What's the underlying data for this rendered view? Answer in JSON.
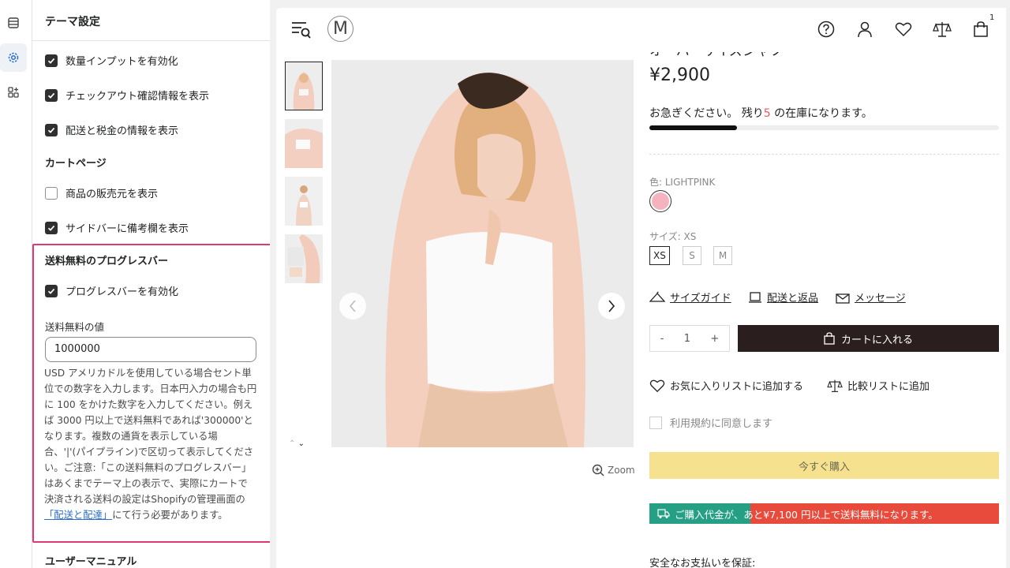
{
  "sidebar": {
    "title": "テーマ設定",
    "options": [
      {
        "label": "数量インプットを有効化",
        "checked": true
      },
      {
        "label": "チェックアウト確認情報を表示",
        "checked": true
      },
      {
        "label": "配送と税金の情報を表示",
        "checked": true
      }
    ],
    "cart_section_title": "カートページ",
    "cart_options": [
      {
        "label": "商品の販売元を表示",
        "checked": false
      },
      {
        "label": "サイドバーに備考欄を表示",
        "checked": true
      }
    ],
    "progress_section_title": "送料無料のプログレスバー",
    "progress_enable_label": "プログレスバーを有効化",
    "free_value_label": "送料無料の値",
    "free_value": "1000000",
    "help_text_before": "USD アメリカドルを使用している場合セント単位での数字を入力します。日本円入力の場合も円に 100 をかけた数字を入力してください。例えば 3000 円以上で送料無料であれば'300000'となります。複数の通貨を表示している場合、'|'(パイプライン)で区切って表示してください。ご注意:「この送料無料のプログレスバー」はあくまでテーマ上の表示で、実際にカートで決済される送料の設定はShopifyの管理画面の",
    "help_link": "「配送と配達」",
    "help_text_after": "にて行う必要があります。",
    "next_section_title": "ユーザーマニュアル"
  },
  "store": {
    "logo_letter": "M",
    "cart_count": "1",
    "title_cut": "オーバーサイズシャツ",
    "price": "¥2,900",
    "hurry_before": "お急ぎください。 残り",
    "hurry_count": "5",
    "hurry_after": " の在庫になります。",
    "stock_fraction": 0.25,
    "color_label": "色: LIGHTPINK",
    "swatch_color": "#f4b3bf",
    "size_label": "サイズ: XS",
    "sizes": [
      "XS",
      "S",
      "M"
    ],
    "size_guide": "サイズガイド",
    "shipping_returns": "配送と返品",
    "message": "メッセージ",
    "qty_minus": "-",
    "qty_value": "1",
    "qty_plus": "+",
    "add_to_cart": "カートに入れる",
    "add_wishlist": "お気に入りリストに追加する",
    "add_compare": "比較リストに追加",
    "terms": "利用規約に同意します",
    "buy_now": "今すぐ購入",
    "free_ship_msg": "ご購入代金が、あと¥7,100 円以上で送料無料になります。",
    "free_ship_fraction": 0.29,
    "zoom": "Zoom",
    "secure": "安全なお支払いを保証:"
  }
}
